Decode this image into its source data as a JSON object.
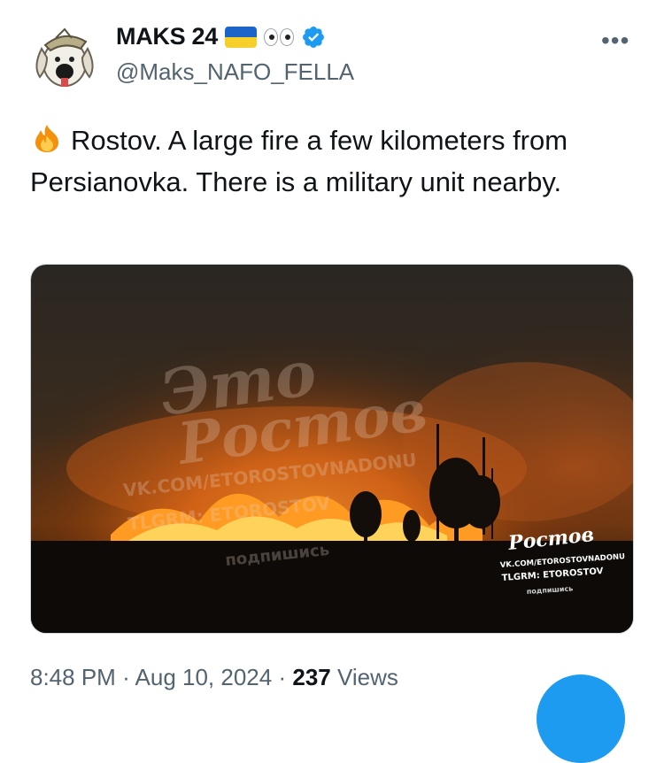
{
  "author": {
    "display_name": "MAKS 24",
    "handle": "@Maks_NAFO_FELLA"
  },
  "tweet": {
    "text": "Rostov. A large fire a few kilometers from Persianovka. There is a military unit nearby."
  },
  "media": {
    "watermark_main_line1": "Это",
    "watermark_main_line2": "Ростов",
    "watermark_url": "VK.COM/ETOROSTOVNADONU",
    "watermark_tg": "TLGRM: ETOROSTOV",
    "watermark_subscribe": "подпишись",
    "watermark_small_url": "VK.COM/ETOROSTOVNADONU",
    "watermark_small_tg": "TLGRM: ETOROSTOV",
    "watermark_small_subscribe": "подпишись"
  },
  "meta": {
    "time": "8:48 PM",
    "separator": "·",
    "date": "Aug 10, 2024",
    "views_count": "237",
    "views_label": "Views"
  },
  "icons": {
    "more": "more-icon",
    "verified": "verified-badge-icon",
    "fire": "fire-emoji-icon",
    "flag": "ukraine-flag-icon",
    "eyes": "eyes-emoji-icon"
  },
  "colors": {
    "accent": "#1d9bf0",
    "text_primary": "#0f1419",
    "text_secondary": "#536471"
  }
}
